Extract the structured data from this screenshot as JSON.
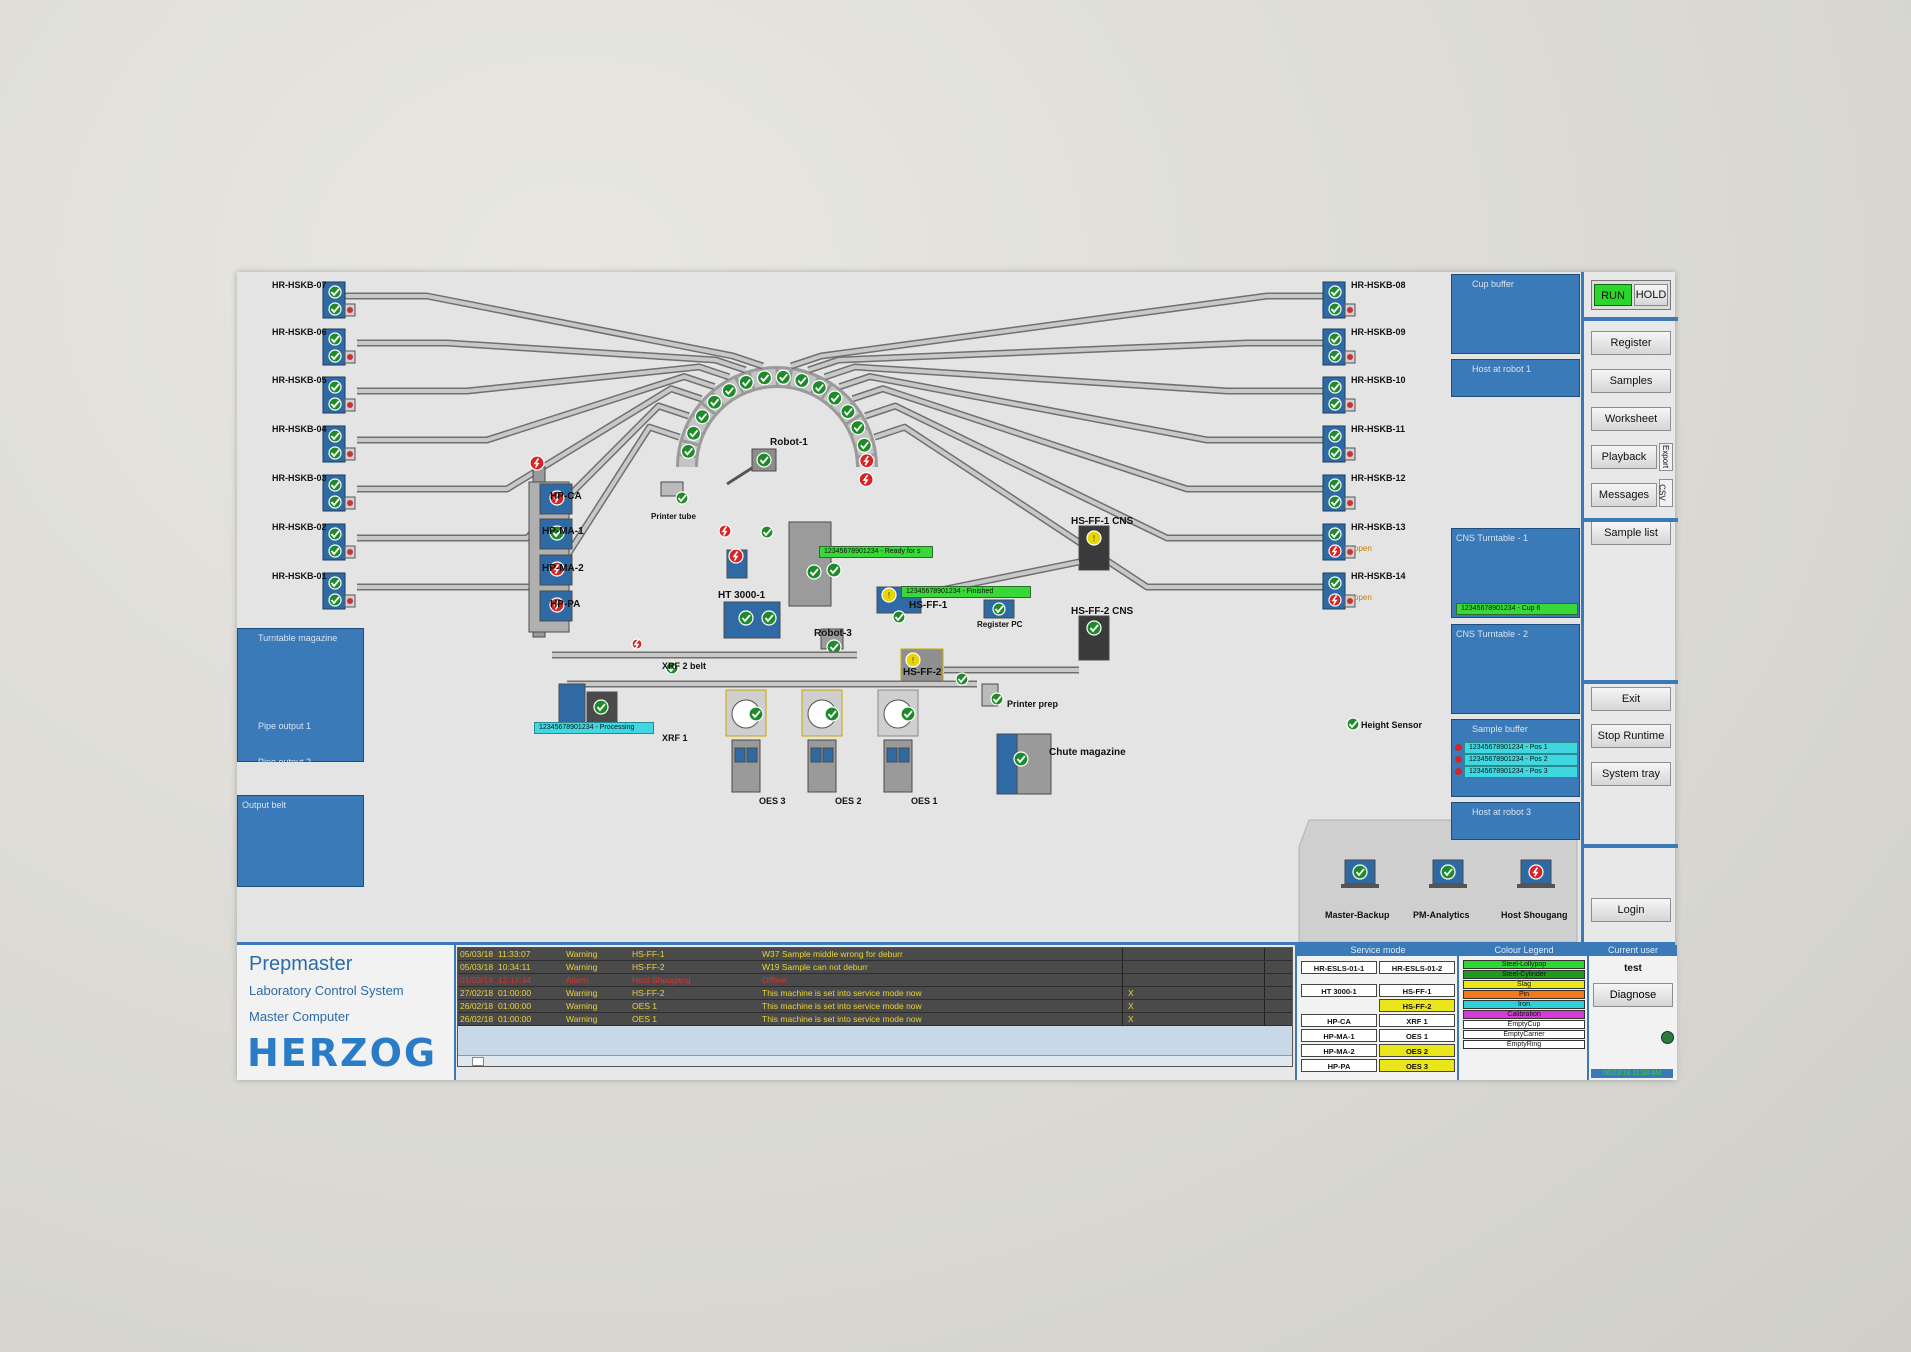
{
  "stations_left": [
    {
      "label": "HR-HSKB-07",
      "state": "ok"
    },
    {
      "label": "HR-HSKB-06",
      "state": "ok"
    },
    {
      "label": "HR-HSKB-05",
      "state": "ok"
    },
    {
      "label": "HR-HSKB-04",
      "state": "ok"
    },
    {
      "label": "HR-HSKB-03",
      "state": "ok"
    },
    {
      "label": "HR-HSKB-02",
      "state": "ok"
    },
    {
      "label": "HR-HSKB-01",
      "state": "ok"
    }
  ],
  "stations_right": [
    {
      "label": "HR-HSKB-08",
      "state": "ok"
    },
    {
      "label": "HR-HSKB-09",
      "state": "ok"
    },
    {
      "label": "HR-HSKB-10",
      "state": "ok"
    },
    {
      "label": "HR-HSKB-11",
      "state": "ok"
    },
    {
      "label": "HR-HSKB-12",
      "state": "ok"
    },
    {
      "label": "HR-HSKB-13",
      "state": "fault",
      "note": "open"
    },
    {
      "label": "HR-HSKB-14",
      "state": "fault",
      "note": "open"
    }
  ],
  "machines": {
    "robot1": "Robot-1",
    "robot3": "Robot-3",
    "printer_tube": "Printer tube",
    "hp_ca": "HP-CA",
    "hp_ma1": "HP-MA-1",
    "hp_ma2": "HP-MA-2",
    "hp_pa": "HP-PA",
    "ht3000": "HT 3000-1",
    "hs_ff1": "HS-FF-1",
    "hs_ff2": "HS-FF-2",
    "hs_ff1_cns": "HS-FF-1 CNS",
    "hs_ff2_cns": "HS-FF-2 CNS",
    "register_pc": "Register PC",
    "xrf2belt": "XRF 2 belt",
    "xrf1": "XRF 1",
    "printer_prep": "Printer prep",
    "chute_magazine": "Chute magazine",
    "oes3": "OES 3",
    "oes2": "OES 2",
    "oes1": "OES 1",
    "height_sensor": "Height Sensor"
  },
  "tags": {
    "ready": "12345678901234 - Ready for s",
    "finished": "12345678901234 - Finished",
    "processing": "12345678901234 - Processing"
  },
  "left_panels": {
    "turntable": "Turntable magazine",
    "pipe1": "Pipe output 1",
    "pipe2": "Pipe output 2",
    "output_belt": "Output belt"
  },
  "right_panels": {
    "cup_buffer": "Cup buffer",
    "host_robot1": "Host at robot 1",
    "cns_turntable1": "CNS Turntable - 1",
    "cns_turntable1_tag": "12345678901234 - Cup 6",
    "cns_turntable2": "CNS Turntable - 2",
    "sample_buffer": "Sample buffer",
    "sample_buffer_items": [
      "12345678901234 - Pos 1",
      "12345678901234 - Pos 2",
      "12345678901234 - Pos 3"
    ],
    "host_robot3": "Host at robot 3"
  },
  "hosts": [
    {
      "label": "Master-Backup",
      "state": "ok"
    },
    {
      "label": "PM-Analytics",
      "state": "ok"
    },
    {
      "label": "Host Shougang",
      "state": "fault"
    }
  ],
  "sidebar": {
    "run": "RUN",
    "hold": "HOLD",
    "buttons": [
      "Register",
      "Samples",
      "Worksheet",
      "Playback",
      "Messages",
      "Sample list"
    ],
    "export": "Export",
    "csv": "CSV",
    "exit": "Exit",
    "stop_runtime": "Stop Runtime",
    "system_tray": "System tray",
    "login": "Login"
  },
  "brand": {
    "app": "Prepmaster",
    "subtitle": "Laboratory Control System",
    "role": "Master Computer",
    "logo": "HERZOG"
  },
  "messages": [
    {
      "date": "05/03/18",
      "time": "11:33:07",
      "type": "Warning",
      "source": "HS-FF-1",
      "text": "W37 Sample middle wrong for deburr",
      "x": "",
      "color": "#e8d33c"
    },
    {
      "date": "05/03/18",
      "time": "10:34:11",
      "type": "Warning",
      "source": "HS-FF-2",
      "text": "W19 Sample can not deburr",
      "x": "",
      "color": "#e8d33c"
    },
    {
      "date": "01/03/18",
      "time": "12:17:44",
      "type": "Alarm",
      "source": "Host Shougang",
      "text": "Offline",
      "x": "",
      "color": "#e03030"
    },
    {
      "date": "27/02/18",
      "time": "01:00:00",
      "type": "Warning",
      "source": "HS-FF-2",
      "text": "This machine is set into service mode now",
      "x": "X",
      "color": "#e8d33c"
    },
    {
      "date": "26/02/18",
      "time": "01:00:00",
      "type": "Warning",
      "source": "OES 1",
      "text": "This machine is set into service mode now",
      "x": "X",
      "color": "#e8d33c"
    },
    {
      "date": "26/02/18",
      "time": "01:00:00",
      "type": "Warning",
      "source": "OES 1",
      "text": "This machine is set into service mode now",
      "x": "X",
      "color": "#e8d33c"
    }
  ],
  "service_mode": {
    "title": "Service mode",
    "rows": [
      [
        {
          "label": "HR-ESLS-01-1",
          "active": false
        },
        {
          "label": "HR-ESLS-01-2",
          "active": false
        }
      ],
      [
        {
          "label": "HT 3000-1",
          "active": false
        },
        {
          "label": "HS-FF-1",
          "active": false
        }
      ],
      [
        {
          "label": "",
          "active": false
        },
        {
          "label": "HS-FF-2",
          "active": true
        }
      ],
      [
        {
          "label": "HP-CA",
          "active": false
        },
        {
          "label": "XRF 1",
          "active": false
        }
      ],
      [
        {
          "label": "HP-MA-1",
          "active": false
        },
        {
          "label": "OES 1",
          "active": false
        }
      ],
      [
        {
          "label": "HP-MA-2",
          "active": false
        },
        {
          "label": "OES 2",
          "active": true
        }
      ],
      [
        {
          "label": "HP-PA",
          "active": false
        },
        {
          "label": "OES 3",
          "active": true
        }
      ]
    ]
  },
  "colour_legend": {
    "title": "Colour Legend",
    "items": [
      {
        "label": "Steel-Lollypop",
        "color": "#2ed82e"
      },
      {
        "label": "Steel-Cylinder",
        "color": "#1e9a1e"
      },
      {
        "label": "Slag",
        "color": "#e9e61c"
      },
      {
        "label": "Pin",
        "color": "#f07a1c"
      },
      {
        "label": "Iron",
        "color": "#2fd0d8"
      },
      {
        "label": "Calibration",
        "color": "#d83ad8"
      },
      {
        "label": "EmptyCup",
        "color": "#ffffff"
      },
      {
        "label": "EmptyCarrier",
        "color": "#ffffff"
      },
      {
        "label": "EmptyRing",
        "color": "#ffffff"
      }
    ]
  },
  "current_user": {
    "title": "Current user",
    "name": "test",
    "diagnose": "Diagnose",
    "status": "06/03/18 11:33 AM"
  },
  "colors": {
    "accent": "#3b7ab8",
    "ok": "#1f8a2a",
    "fault": "#d62424",
    "warn": "#e8d600"
  }
}
